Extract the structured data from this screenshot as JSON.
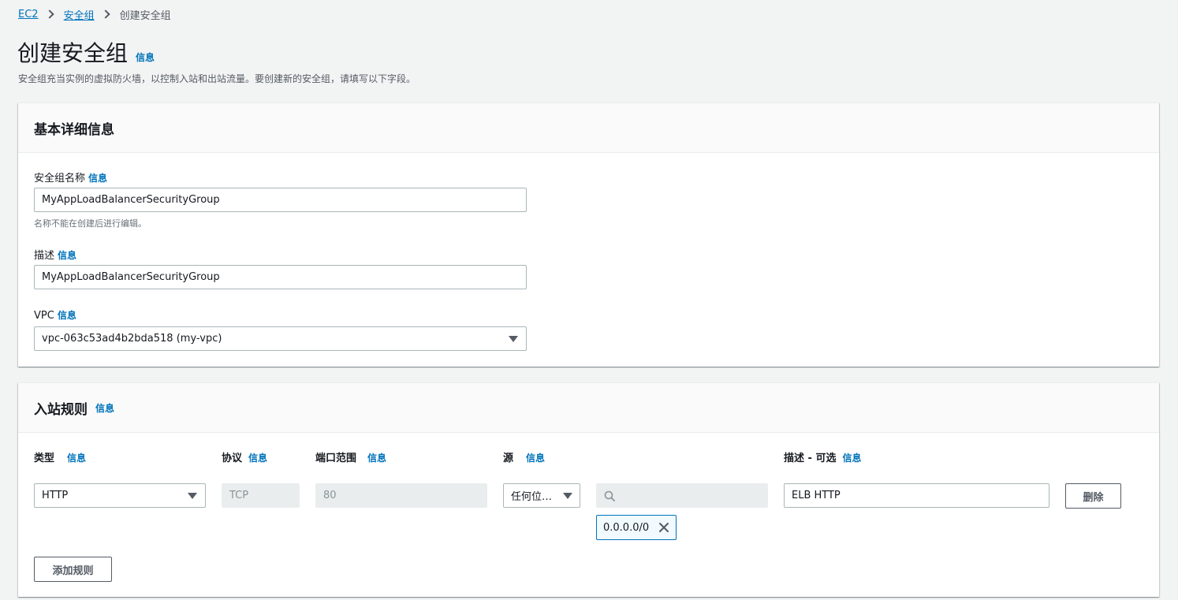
{
  "breadcrumb": {
    "items": [
      "EC2",
      "安全组"
    ],
    "current": "创建安全组"
  },
  "page": {
    "title": "创建安全组",
    "info": "信息",
    "description": "安全组充当实例的虚拟防火墙，以控制入站和出站流量。要创建新的安全组，请填写以下字段。"
  },
  "basic_details": {
    "title": "基本详细信息",
    "name_label": "安全组名称",
    "name_info": "信息",
    "name_value": "MyAppLoadBalancerSecurityGroup",
    "name_hint": "名称不能在创建后进行编辑。",
    "desc_label": "描述",
    "desc_info": "信息",
    "desc_value": "MyAppLoadBalancerSecurityGroup",
    "vpc_label": "VPC",
    "vpc_info": "信息",
    "vpc_value": "vpc-063c53ad4b2bda518 (my-vpc)"
  },
  "inbound_rules": {
    "title": "入站规则",
    "info": "信息",
    "columns": {
      "type": "类型",
      "protocol": "协议",
      "port_range": "端口范围",
      "source": "源",
      "description": "描述 - 可选",
      "info": "信息"
    },
    "rule": {
      "type": "HTTP",
      "protocol": "TCP",
      "port_range": "80",
      "source": "任何位…",
      "search_placeholder": "",
      "cidr_token": "0.0.0.0/0",
      "description": "ELB HTTP",
      "delete_label": "删除"
    },
    "add_rule_label": "添加规则"
  },
  "colors": {
    "link": "#0073bb",
    "page_bg": "#f2f3f3",
    "panel_header_bg": "#fafafa",
    "disabled_bg": "#eaeded"
  }
}
